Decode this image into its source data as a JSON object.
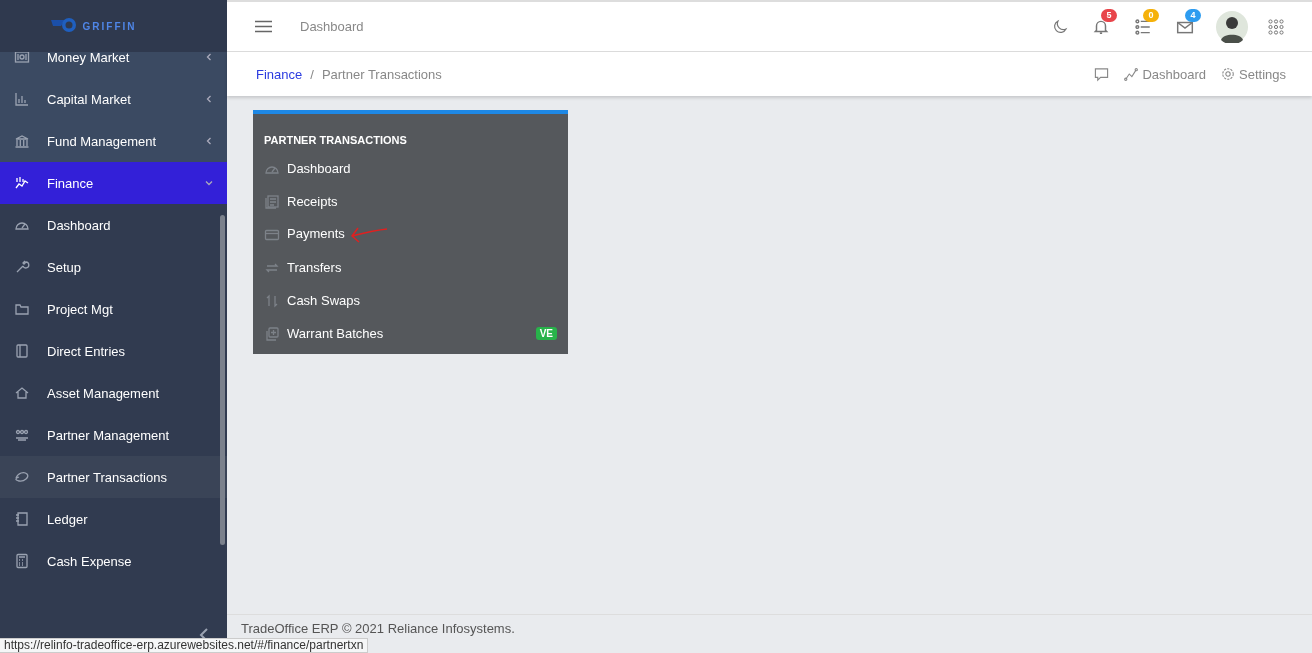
{
  "sidebar": {
    "logo": "GRIFFIN",
    "items": [
      {
        "label": "Money Market",
        "kind": "group",
        "expanded": false,
        "selected": false
      },
      {
        "label": "Capital Market",
        "kind": "group",
        "expanded": false,
        "selected": false
      },
      {
        "label": "Fund Management",
        "kind": "group",
        "expanded": false,
        "selected": false
      },
      {
        "label": "Finance",
        "kind": "group",
        "expanded": true,
        "selected": true,
        "children": [
          {
            "label": "Dashboard",
            "selected": false
          },
          {
            "label": "Setup",
            "selected": false
          },
          {
            "label": "Project Mgt",
            "selected": false
          },
          {
            "label": "Direct Entries",
            "selected": false
          },
          {
            "label": "Asset Management",
            "selected": false
          },
          {
            "label": "Partner Management",
            "selected": false
          },
          {
            "label": "Partner Transactions",
            "selected": true
          },
          {
            "label": "Ledger",
            "selected": false
          },
          {
            "label": "Cash Expense",
            "selected": false
          }
        ]
      }
    ]
  },
  "topbar": {
    "title": "Dashboard",
    "indicators": [
      {
        "count": "5",
        "color": "#e8454b"
      },
      {
        "count": "0",
        "color": "#f5b10a"
      },
      {
        "count": "4",
        "color": "#2d9cf0"
      }
    ]
  },
  "breadcrumb": {
    "items": [
      "Finance",
      "Partner Transactions"
    ],
    "separator": "/",
    "actions": [
      "Dashboard",
      "Settings"
    ]
  },
  "card": {
    "title": "PARTNER TRANSACTIONS",
    "items": [
      {
        "label": "Dashboard"
      },
      {
        "label": "Receipts"
      },
      {
        "label": "Payments",
        "annotated": true
      },
      {
        "label": "Transfers"
      },
      {
        "label": "Cash Swaps"
      },
      {
        "label": "Warrant Batches",
        "badge": "VE"
      }
    ]
  },
  "footer": {
    "text": "TradeOffice ERP © 2021 Reliance Infosystems."
  },
  "status_url": "https://relinfo-tradeoffice-erp.azurewebsites.net/#/finance/partnertxn"
}
